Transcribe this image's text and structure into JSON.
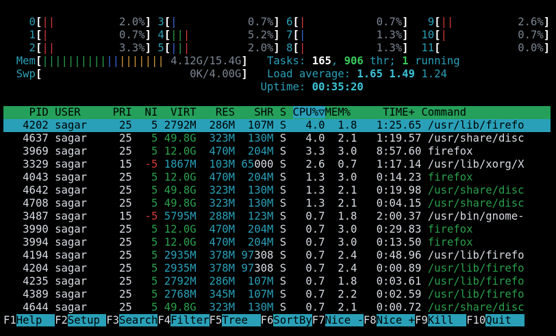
{
  "cpu_meters": [
    {
      "id": "0",
      "bars": [
        {
          "c": "rd",
          "t": "|"
        },
        {
          "c": "rd",
          "t": "|"
        }
      ],
      "pct": "2.0%"
    },
    {
      "id": "1",
      "bars": [
        {
          "c": "rd",
          "t": "|"
        }
      ],
      "pct": "0.7%"
    },
    {
      "id": "2",
      "bars": [
        {
          "c": "rd",
          "t": "|"
        },
        {
          "c": "rd",
          "t": "|"
        }
      ],
      "pct": "3.3%"
    },
    {
      "id": "3",
      "bars": [
        {
          "c": "bl",
          "t": "|"
        }
      ],
      "pct": "0.7%"
    },
    {
      "id": "4",
      "bars": [
        {
          "c": "gr",
          "t": "|"
        },
        {
          "c": "gr",
          "t": "|"
        },
        {
          "c": "rd",
          "t": "|"
        }
      ],
      "pct": "5.2%"
    },
    {
      "id": "5",
      "bars": [
        {
          "c": "bl",
          "t": "|"
        },
        {
          "c": "gr",
          "t": "|"
        },
        {
          "c": "rd",
          "t": "|"
        }
      ],
      "pct": "2.0%"
    },
    {
      "id": "6",
      "bars": [
        {
          "c": "rd",
          "t": "|"
        }
      ],
      "pct": "0.7%"
    },
    {
      "id": "7",
      "bars": [
        {
          "c": "bl",
          "t": "|"
        }
      ],
      "pct": "1.3%"
    },
    {
      "id": "8",
      "bars": [
        {
          "c": "rd",
          "t": "|"
        }
      ],
      "pct": "1.3%"
    },
    {
      "id": "9",
      "bars": [
        {
          "c": "rd",
          "t": "|"
        },
        {
          "c": "rd",
          "t": "|"
        }
      ],
      "pct": "2.6%"
    },
    {
      "id": "10",
      "bars": [
        {
          "c": "rd",
          "t": "|"
        }
      ],
      "pct": "0.7%"
    },
    {
      "id": "11",
      "bars": [],
      "pct": "0.0%"
    }
  ],
  "mem": {
    "label": "Mem",
    "value": "4.12G/15.4G",
    "bars_green": 10,
    "bars_blue": 2,
    "bars_orange": 7
  },
  "swp": {
    "label": "Swp",
    "value": "0K/4.00G"
  },
  "tasks": {
    "label": "Tasks:",
    "count": "165",
    "thr": "906",
    "thr_label": "thr;",
    "running": "1",
    "running_label": "running"
  },
  "load": {
    "label": "Load average:",
    "l1": "1.65",
    "l5": "1.49",
    "l15": "1.24"
  },
  "uptime": {
    "label": "Uptime:",
    "value": "00:35:20"
  },
  "columns": {
    "pid": "PID",
    "user": "USER",
    "pri": "PRI",
    "ni": "NI",
    "virt": "VIRT",
    "res": "RES",
    "shr": "SHR",
    "s": "S",
    "cpu": "CPU%▽",
    "mem": "MEM%",
    "time": "TIME+",
    "command": "Command"
  },
  "processes": [
    {
      "pid": "4202",
      "user": "sagar",
      "pri": "25",
      "ni": "5",
      "virt": "2792M",
      "res": "286M",
      "shr": "107M",
      "s": "S",
      "cpu": "4.0",
      "mem": "1.8",
      "time": "1:25.65",
      "cmd": "/usr/lib/firefo",
      "cmd_color": "d",
      "virt_color": "d",
      "selected": true
    },
    {
      "pid": "4637",
      "user": "sagar",
      "pri": "25",
      "ni": "5",
      "virt": "49.8G",
      "res": "323M",
      "shr": "130M",
      "s": "S",
      "cpu": "4.0",
      "mem": "2.1",
      "time": "1:19.57",
      "cmd": "/usr/share/disc",
      "cmd_color": "d",
      "virt_color": "gr"
    },
    {
      "pid": "3969",
      "user": "sagar",
      "pri": "25",
      "ni": "5",
      "virt": "12.0G",
      "res": "470M",
      "shr": "204M",
      "s": "S",
      "cpu": "3.3",
      "mem": "3.0",
      "time": "8:57.60",
      "cmd": "firefox",
      "cmd_color": "d",
      "virt_color": "gr"
    },
    {
      "pid": "3329",
      "user": "sagar",
      "pri": "15",
      "ni": "-5",
      "virt": "1867M",
      "res": "103M",
      "shr": "65000",
      "s": "S",
      "cpu": "2.6",
      "mem": "0.7",
      "time": "1:17.14",
      "cmd": "/usr/lib/xorg/X",
      "cmd_color": "d",
      "virt_color": "cy",
      "ni_color": "rd"
    },
    {
      "pid": "4043",
      "user": "sagar",
      "pri": "25",
      "ni": "5",
      "virt": "12.0G",
      "res": "470M",
      "shr": "204M",
      "s": "S",
      "cpu": "1.3",
      "mem": "3.0",
      "time": "0:14.23",
      "cmd": "firefox",
      "cmd_color": "gr",
      "virt_color": "gr"
    },
    {
      "pid": "4642",
      "user": "sagar",
      "pri": "25",
      "ni": "5",
      "virt": "49.8G",
      "res": "323M",
      "shr": "130M",
      "s": "S",
      "cpu": "1.3",
      "mem": "2.1",
      "time": "0:19.98",
      "cmd": "/usr/share/disc",
      "cmd_color": "gr",
      "virt_color": "gr"
    },
    {
      "pid": "4708",
      "user": "sagar",
      "pri": "25",
      "ni": "5",
      "virt": "49.8G",
      "res": "323M",
      "shr": "130M",
      "s": "S",
      "cpu": "1.3",
      "mem": "2.1",
      "time": "0:04.15",
      "cmd": "/usr/share/disc",
      "cmd_color": "gr",
      "virt_color": "gr"
    },
    {
      "pid": "3487",
      "user": "sagar",
      "pri": "15",
      "ni": "-5",
      "virt": "5795M",
      "res": "288M",
      "shr": "123M",
      "s": "S",
      "cpu": "0.7",
      "mem": "1.8",
      "time": "2:00.37",
      "cmd": "/usr/bin/gnome-",
      "cmd_color": "d",
      "virt_color": "cy",
      "ni_color": "rd"
    },
    {
      "pid": "3990",
      "user": "sagar",
      "pri": "25",
      "ni": "5",
      "virt": "12.0G",
      "res": "470M",
      "shr": "204M",
      "s": "S",
      "cpu": "0.7",
      "mem": "3.0",
      "time": "0:29.83",
      "cmd": "firefox",
      "cmd_color": "gr",
      "virt_color": "gr"
    },
    {
      "pid": "3994",
      "user": "sagar",
      "pri": "25",
      "ni": "5",
      "virt": "12.0G",
      "res": "470M",
      "shr": "204M",
      "s": "S",
      "cpu": "0.7",
      "mem": "3.0",
      "time": "0:13.50",
      "cmd": "firefox",
      "cmd_color": "gr",
      "virt_color": "gr"
    },
    {
      "pid": "4194",
      "user": "sagar",
      "pri": "25",
      "ni": "5",
      "virt": "2935M",
      "res": "378M",
      "shr": "97308",
      "s": "S",
      "cpu": "0.7",
      "mem": "2.4",
      "time": "0:48.96",
      "cmd": "/usr/lib/firefo",
      "cmd_color": "d",
      "virt_color": "cy"
    },
    {
      "pid": "4204",
      "user": "sagar",
      "pri": "25",
      "ni": "5",
      "virt": "2935M",
      "res": "378M",
      "shr": "97308",
      "s": "S",
      "cpu": "0.7",
      "mem": "2.4",
      "time": "0:00.89",
      "cmd": "/usr/lib/firefo",
      "cmd_color": "gr",
      "virt_color": "cy"
    },
    {
      "pid": "4235",
      "user": "sagar",
      "pri": "25",
      "ni": "5",
      "virt": "2792M",
      "res": "286M",
      "shr": "107M",
      "s": "S",
      "cpu": "0.7",
      "mem": "1.8",
      "time": "0:03.61",
      "cmd": "/usr/lib/firefo",
      "cmd_color": "gr",
      "virt_color": "cy"
    },
    {
      "pid": "4389",
      "user": "sagar",
      "pri": "25",
      "ni": "5",
      "virt": "2768M",
      "res": "345M",
      "shr": "107M",
      "s": "S",
      "cpu": "0.7",
      "mem": "2.2",
      "time": "0:02.59",
      "cmd": "/usr/lib/firefo",
      "cmd_color": "gr",
      "virt_color": "cy"
    },
    {
      "pid": "4644",
      "user": "sagar",
      "pri": "25",
      "ni": "5",
      "virt": "49.8G",
      "res": "323M",
      "shr": "130M",
      "s": "S",
      "cpu": "0.7",
      "mem": "2.1",
      "time": "0:00.72",
      "cmd": "/usr/share/disc",
      "cmd_color": "gr",
      "virt_color": "gr"
    }
  ],
  "function_keys": [
    {
      "key": "F1",
      "label": "Help  "
    },
    {
      "key": "F2",
      "label": "Setup "
    },
    {
      "key": "F3",
      "label": "Search"
    },
    {
      "key": "F4",
      "label": "Filter"
    },
    {
      "key": "F5",
      "label": "Tree  "
    },
    {
      "key": "F6",
      "label": "SortBy"
    },
    {
      "key": "F7",
      "label": "Nice -"
    },
    {
      "key": "F8",
      "label": "Nice +"
    },
    {
      "key": "F9",
      "label": "Kill  "
    },
    {
      "key": "F10",
      "label": "Quit  "
    }
  ],
  "colors": {
    "header_bg": "#25a05a",
    "selected_bg": "#2aa0b8",
    "cyan": "#2aa0b8",
    "green": "#2aa04c",
    "red": "#d63a3a",
    "blue": "#3b66d6",
    "orange": "#d09a3a"
  }
}
